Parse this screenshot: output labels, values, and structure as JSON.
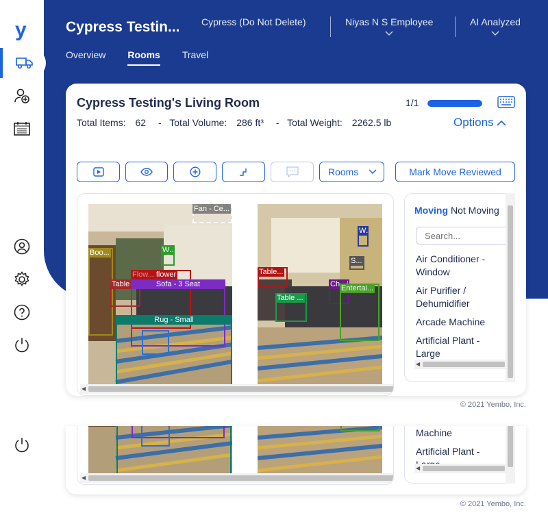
{
  "app": {
    "logo": "y"
  },
  "nav": {
    "items": [
      {
        "name": "truck-icon",
        "active": true
      },
      {
        "name": "add-user-icon"
      },
      {
        "name": "calendar-icon"
      },
      {
        "name": "profile-icon"
      },
      {
        "name": "settings-icon"
      },
      {
        "name": "help-icon"
      },
      {
        "name": "power-icon"
      }
    ]
  },
  "header": {
    "title": "Cypress Testin...",
    "account": "Cypress (Do Not Delete)",
    "user": "Niyas N S Employee",
    "status": "AI Analyzed"
  },
  "tabs": [
    {
      "label": "Overview"
    },
    {
      "label": "Rooms",
      "active": true
    },
    {
      "label": "Travel"
    }
  ],
  "room": {
    "title": "Cypress Testing's Living Room",
    "page": "1/1",
    "progress_fraction": 1.0,
    "stats": {
      "items_label": "Total Items:",
      "items_value": "62",
      "volume_label": "Total Volume:",
      "volume_value": "286 ft³",
      "weight_label": "Total Weight:",
      "weight_value": "2262.5 lb",
      "sep": "-"
    },
    "options_label": "Options"
  },
  "toolbar": {
    "rooms_label": "Rooms",
    "mark_reviewed_label": "Mark Move Reviewed",
    "icons": [
      "play-icon",
      "eye-icon",
      "add-circle-icon",
      "corner-icon",
      "comment-icon"
    ]
  },
  "photo1_labels": {
    "fan": "Fan - Ce...",
    "books": "Boo...",
    "w": "W...",
    "flower": "flower",
    "flow_bg": "Flow...",
    "table": "Table ...",
    "sofa": "Sofa - 3 Seat",
    "rug": "Rug - Small"
  },
  "photo2_labels": {
    "w": "W...",
    "s": "S...",
    "table1": "Table...",
    "ch": "Ch...",
    "entertain": "Entertai...",
    "table2": "Table ..."
  },
  "items_panel": {
    "tab_moving": "Moving",
    "tab_not_moving": "Not Moving",
    "search_placeholder": "Search...",
    "items": [
      "Air Conditioner - Window",
      "Air Purifier / Dehumidifier",
      "Arcade Machine",
      "Artificial Plant - Large"
    ]
  },
  "lower": {
    "items": [
      "Machine",
      "Artificial Plant - Large"
    ]
  },
  "footer": {
    "copyright": "© 2021 Yembo, Inc."
  }
}
